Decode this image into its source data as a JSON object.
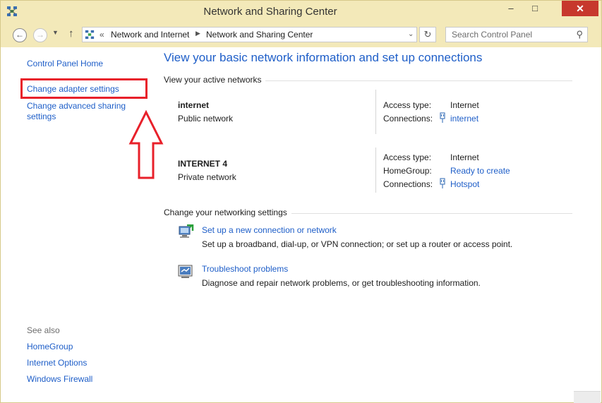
{
  "window": {
    "title": "Network and Sharing Center",
    "controls": {
      "minimize": "–",
      "maximize": "□",
      "close": "✕"
    }
  },
  "nav": {
    "back_icon": "arrow-left-icon",
    "forward_icon": "arrow-right-icon",
    "up_icon": "arrow-up-icon",
    "address_prefix": "«",
    "breadcrumbs": [
      "Network and Internet",
      "Network and Sharing Center"
    ],
    "search_placeholder": "Search Control Panel"
  },
  "sidebar": {
    "home": "Control Panel Home",
    "items": [
      "Change adapter settings",
      "Change advanced sharing settings"
    ],
    "see_also_label": "See also",
    "see_also": [
      "HomeGroup",
      "Internet Options",
      "Windows Firewall"
    ]
  },
  "main": {
    "heading": "View your basic network information and set up connections",
    "active_networks_label": "View your active networks",
    "networks": [
      {
        "name": "internet",
        "type": "Public network",
        "access_label": "Access type:",
        "access_value": "Internet",
        "connections_label": "Connections:",
        "connections_value": "internet"
      },
      {
        "name": "INTERNET  4",
        "type": "Private network",
        "access_label": "Access type:",
        "access_value": "Internet",
        "homegroup_label": "HomeGroup:",
        "homegroup_value": "Ready to create",
        "connections_label": "Connections:",
        "connections_value": "Hotspot"
      }
    ],
    "settings_label": "Change your networking settings",
    "tasks": [
      {
        "title": "Set up a new connection or network",
        "description": "Set up a broadband, dial-up, or VPN connection; or set up a router or access point."
      },
      {
        "title": "Troubleshoot problems",
        "description": "Diagnose and repair network problems, or get troubleshooting information."
      }
    ]
  },
  "colors": {
    "link": "#1e5ec8",
    "titlebar": "#f3e9b9",
    "close_button": "#c7382d",
    "annotation": "#e8202a"
  }
}
